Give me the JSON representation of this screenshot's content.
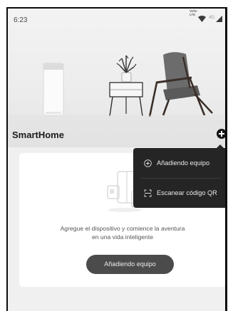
{
  "status_bar": {
    "time": "6:23",
    "volte_label": "Volte LTE",
    "network_label": "4G"
  },
  "header": {
    "title": "SmartHome"
  },
  "add_menu": {
    "items": [
      {
        "label": "Añadiendo equipo",
        "icon": "plus-circle-icon"
      },
      {
        "label": "Escanear código QR",
        "icon": "qr-scan-icon"
      }
    ]
  },
  "empty_state": {
    "line1": "Agregue el dispositivo y comience la aventura",
    "line2": "en una vida inteligente",
    "button_label": "Añadiendo equipo",
    "illustration_icon": "appliance-illustration-icon"
  },
  "colors": {
    "menu_background": "#252525",
    "button_background": "#4b4b4b",
    "screen_background": "#f0f0f0"
  }
}
